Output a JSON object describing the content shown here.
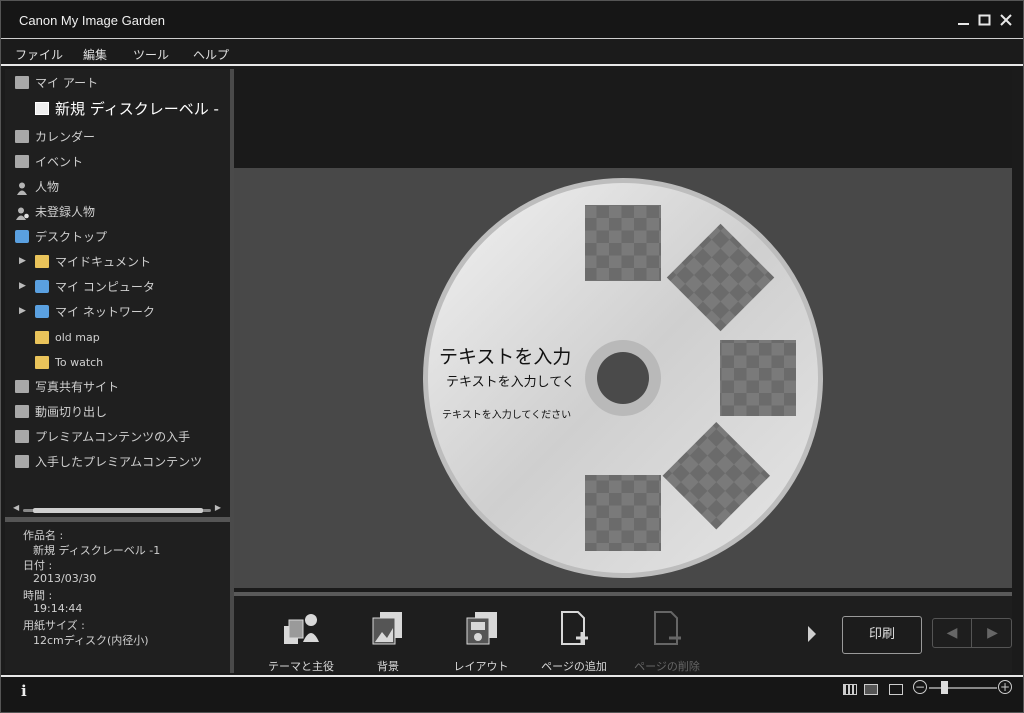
{
  "window": {
    "title": "Canon My Image Garden"
  },
  "menu": [
    "ファイル",
    "編集",
    "ツール",
    "ヘルプ"
  ],
  "sidebar": {
    "items": [
      {
        "label": "マイ アート"
      },
      {
        "label": "新規 ディスクレーベル -"
      },
      {
        "label": "カレンダー"
      },
      {
        "label": "イベント"
      },
      {
        "label": "人物"
      },
      {
        "label": "未登録人物"
      },
      {
        "label": "デスクトップ"
      },
      {
        "label": "マイドキュメント"
      },
      {
        "label": "マイ コンピュータ"
      },
      {
        "label": "マイ ネットワーク"
      },
      {
        "label": "old map"
      },
      {
        "label": "To watch"
      },
      {
        "label": "写真共有サイト"
      },
      {
        "label": "動画切り出し"
      },
      {
        "label": "プレミアムコンテンツの入手"
      },
      {
        "label": "入手したプレミアムコンテンツ"
      }
    ]
  },
  "info": {
    "name_label": "作品名 :",
    "name_value": "新規 ディスクレーベル -1",
    "date_label": "日付 :",
    "date_value": "2013/03/30",
    "time_label": "時間 :",
    "time_value": "19:14:44",
    "paper_label": "用紙サイズ :",
    "paper_value": "12cmディスク(内径小)"
  },
  "disc": {
    "title_text": "テキストを入力",
    "subtitle_text": "テキストを入力してく",
    "body_text": "テキストを入力してください"
  },
  "toolbar": {
    "tools": [
      {
        "label": "テーマと主役",
        "enabled": true
      },
      {
        "label": "背景",
        "enabled": true
      },
      {
        "label": "レイアウト",
        "enabled": true
      },
      {
        "label": "ページの追加",
        "enabled": true
      },
      {
        "label": "ページの削除",
        "enabled": false
      }
    ],
    "print_label": "印刷"
  },
  "status": {
    "info_glyph": "i"
  },
  "colors": {
    "background": "#1b1b1b",
    "canvas": "#484848",
    "folder": "#e9c35a"
  }
}
